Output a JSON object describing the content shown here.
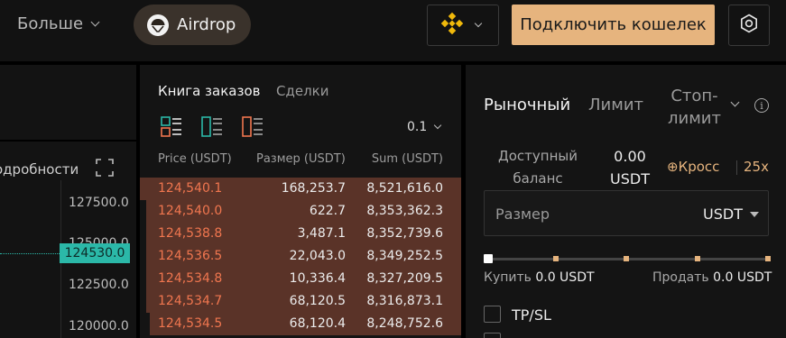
{
  "header": {
    "more_label": "Больше",
    "airdrop_label": "Airdrop",
    "connect_label": "Подключить кошелек",
    "accent_color": "#e6b47e"
  },
  "chart": {
    "details_label": "одробности",
    "y_ticks": [
      "127500.0",
      "125000.0",
      "122500.0",
      "120000.0"
    ],
    "last_price": "124530.0",
    "price_color": "#2bb8a8"
  },
  "orderbook": {
    "tab_book": "Книга заказов",
    "tab_trades": "Сделки",
    "precision": "0.1",
    "col_price": "Price (USDT)",
    "col_size": "Размер (USDT)",
    "col_sum": "Sum (USDT)",
    "ask_color": "#f0764f",
    "rows": [
      {
        "price": "124,540.1",
        "size": "168,253.7",
        "sum": "8,521,616.0",
        "depth": 1.0
      },
      {
        "price": "124,540.0",
        "size": "622.7",
        "sum": "8,353,362.3",
        "depth": 0.98
      },
      {
        "price": "124,538.8",
        "size": "3,487.1",
        "sum": "8,352,739.6",
        "depth": 0.98
      },
      {
        "price": "124,536.5",
        "size": "22,043.0",
        "sum": "8,349,252.5",
        "depth": 0.98
      },
      {
        "price": "124,534.8",
        "size": "10,336.4",
        "sum": "8,327,209.5",
        "depth": 0.98
      },
      {
        "price": "124,534.7",
        "size": "68,120.5",
        "sum": "8,316,873.1",
        "depth": 0.98
      },
      {
        "price": "124,534.5",
        "size": "68,120.4",
        "sum": "8,248,752.6",
        "depth": 0.97
      }
    ]
  },
  "trade": {
    "tab_market": "Рыночный",
    "tab_limit": "Лимит",
    "tab_stop_line1": "Стоп-",
    "tab_stop_line2": "лимит",
    "balance_label_1": "Доступный",
    "balance_label_2": "баланс",
    "balance_value_1": "0.00",
    "balance_value_2": "USDT",
    "margin_mode": "⊕Кросс",
    "leverage": "25x",
    "size_label": "Размер",
    "size_unit": "USDT",
    "slider_percent": 0,
    "buy_label": "Купить",
    "buy_value": "0.0 USDT",
    "sell_label": "Продать",
    "sell_value": "0.0 USDT",
    "tpsl_label": "TP/SL"
  }
}
